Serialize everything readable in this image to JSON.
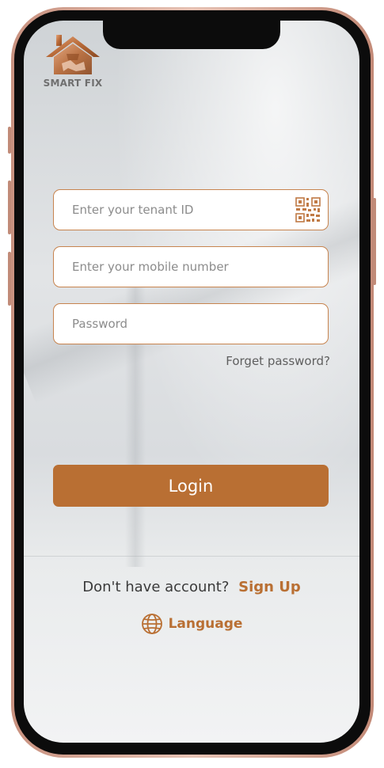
{
  "app": {
    "logo_text": "SMART FIX",
    "brand_color": "#b96f33"
  },
  "form": {
    "tenant_placeholder": "Enter your tenant ID",
    "tenant_value": "",
    "mobile_placeholder": "Enter your mobile number",
    "mobile_value": "",
    "password_placeholder": "Password",
    "password_value": "",
    "qr_icon": "qr-code-icon",
    "forgot_label": "Forget password?",
    "login_label": "Login"
  },
  "footer": {
    "no_account_text": "Don't have account?",
    "signup_label": "Sign Up",
    "language_icon": "globe-icon",
    "language_label": "Language"
  }
}
